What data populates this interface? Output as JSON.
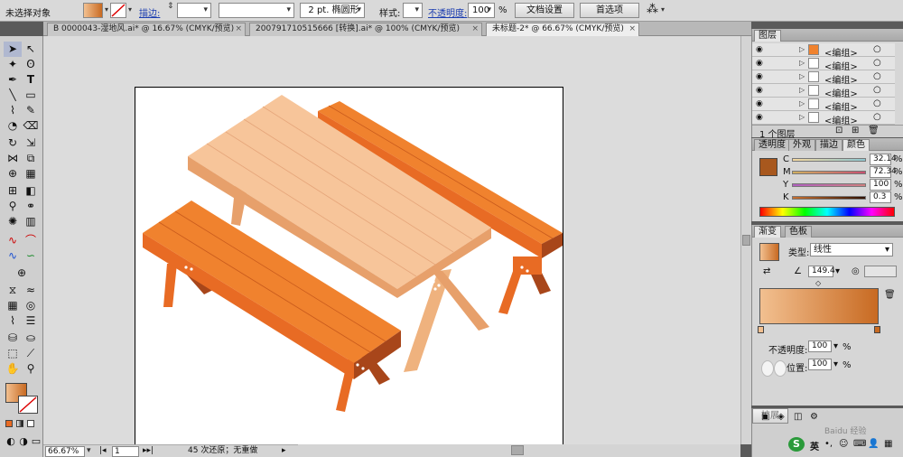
{
  "control_bar": {
    "selection_status": "未选择对象",
    "stroke_link": "描边:",
    "brush_size": "2 pt. 椭圆形",
    "style_label": "样式:",
    "opacity_link": "不透明度:",
    "opacity_value": "100",
    "opacity_unit": "%",
    "doc_setup_button": "文档设置",
    "preferences_button": "首选项"
  },
  "tabs": [
    {
      "label": "B 0000043-湿地风.ai* @ 16.67% (CMYK/预览)",
      "close": "×"
    },
    {
      "label": "200791710515666 [转换].ai* @ 100% (CMYK/预览)",
      "close": "×"
    },
    {
      "label": "未标题-2* @ 66.67% (CMYK/预览)",
      "close": "×"
    }
  ],
  "status_bar": {
    "zoom": "66.67%",
    "page": "1",
    "history": "45 次还原；无重做"
  },
  "layers_panel": {
    "title": "图层",
    "rows": [
      {
        "name": "<编组>"
      },
      {
        "name": "<编组>"
      },
      {
        "name": "<编组>"
      },
      {
        "name": "<编组>"
      },
      {
        "name": "<编组>"
      },
      {
        "name": "<编组>"
      }
    ],
    "footer_count": "1 个图层"
  },
  "color_panel": {
    "tabs": [
      "透明度",
      "外观",
      "描边",
      "颜色"
    ],
    "channels": [
      {
        "label": "C",
        "value": "32.14",
        "unit": "%"
      },
      {
        "label": "M",
        "value": "72.34",
        "unit": "%"
      },
      {
        "label": "Y",
        "value": "100",
        "unit": "%"
      },
      {
        "label": "K",
        "value": "0.3",
        "unit": "%"
      }
    ]
  },
  "gradient_panel": {
    "tabs": [
      "渐变",
      "色板"
    ],
    "type_label": "类型:",
    "type_value": "线性",
    "angle_value": "149.4",
    "opacity_label": "不透明度:",
    "opacity_value": "100",
    "position_label": "位置:",
    "position_value": "100",
    "unit": "%"
  },
  "bottom_panel": {
    "expand_button": "扩展",
    "ime_label": "英",
    "watermark": "Baidu 经验"
  },
  "colors": {
    "bench_front": "#e86b24",
    "bench_top": "#f0822e",
    "bench_dark": "#a8461a",
    "table_top": "#f7c59a",
    "table_side": "#e7a06b",
    "table_leg": "#efb27e"
  }
}
